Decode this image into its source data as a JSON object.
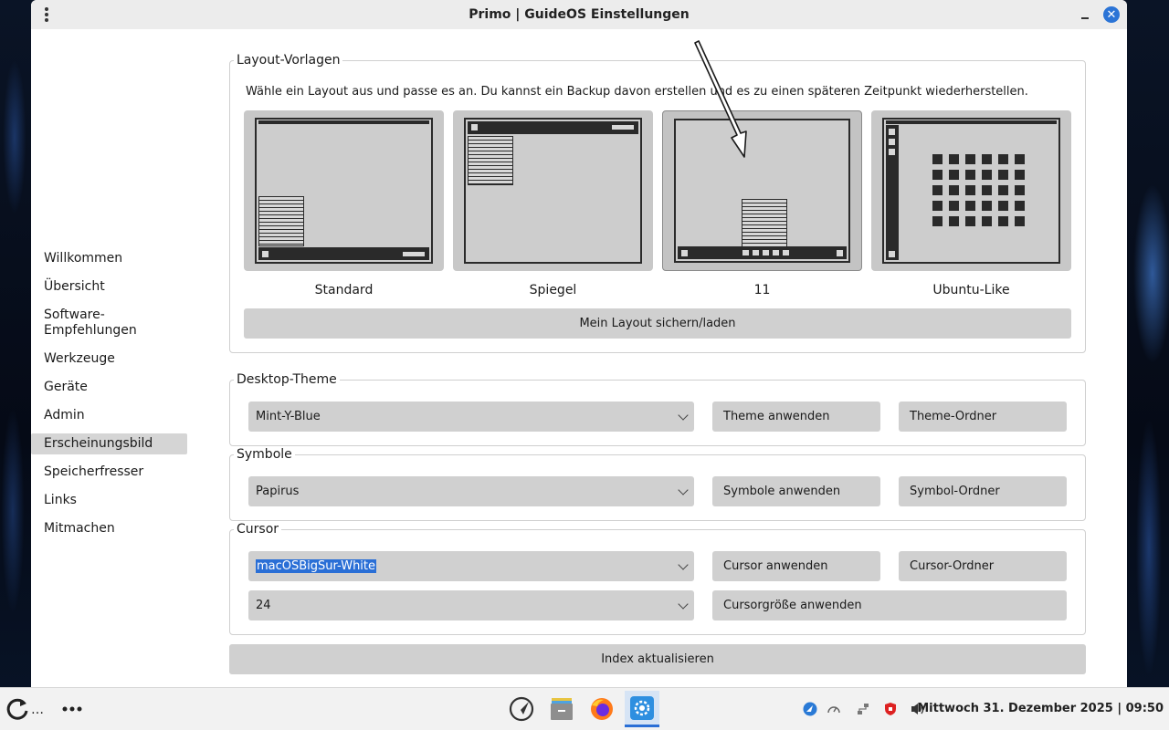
{
  "window": {
    "title": "Primo | GuideOS Einstellungen",
    "menu_icon": "kebab-menu-icon",
    "close_icon": "close-icon",
    "minimize_icon": "minimize-icon"
  },
  "sidebar": {
    "items": [
      {
        "label": "Willkommen"
      },
      {
        "label": "Übersicht"
      },
      {
        "label": "Software-\nEmpfehlungen"
      },
      {
        "label": "Werkzeuge"
      },
      {
        "label": "Geräte"
      },
      {
        "label": "Admin"
      },
      {
        "label": "Erscheinungsbild",
        "active": true
      },
      {
        "label": "Speicherfresser"
      },
      {
        "label": "Links"
      },
      {
        "label": "Mitmachen"
      }
    ]
  },
  "layouts": {
    "title": "Layout-Vorlagen",
    "description": "Wähle ein Layout aus und passe es an. Du kannst ein Backup davon erstellen und es zu einen späteren Zeitpunkt wiederherstellen.",
    "options": [
      {
        "label": "Standard"
      },
      {
        "label": "Spiegel"
      },
      {
        "label": "11",
        "selected": true
      },
      {
        "label": "Ubuntu-Like"
      }
    ],
    "save_button": "Mein Layout sichern/laden"
  },
  "desktop_theme": {
    "title": "Desktop-Theme",
    "value": "Mint-Y-Blue",
    "apply_button": "Theme anwenden",
    "folder_button": "Theme-Ordner"
  },
  "icons_section": {
    "title": "Symbole",
    "value": "Papirus",
    "apply_button": "Symbole anwenden",
    "folder_button": "Symbol-Ordner"
  },
  "cursor": {
    "title": "Cursor",
    "value": "macOSBigSur-White",
    "apply_button": "Cursor anwenden",
    "folder_button": "Cursor-Ordner",
    "size_value": "24",
    "size_button": "Cursorgröße anwenden"
  },
  "index_button": "Index aktualisieren",
  "taskbar": {
    "start_icon": "refresh-start-icon",
    "ellipsis": "…",
    "more_icon": "more-dots-icon",
    "apps": [
      "guideos-launcher-icon",
      "file-manager-icon",
      "firefox-icon",
      "settings-gear-icon"
    ],
    "tray": [
      "update-icon",
      "speedometer-icon",
      "network-icon",
      "shield-icon",
      "volume-icon"
    ],
    "clock": "Mittwoch 31. Dezember 2025 | 09:50"
  }
}
